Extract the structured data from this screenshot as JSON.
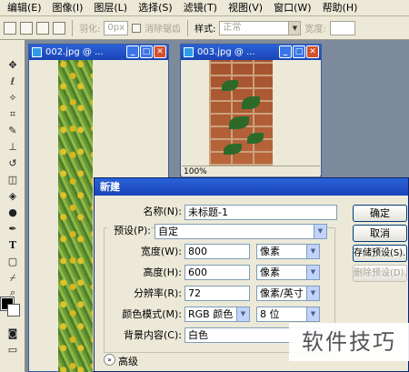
{
  "menu": [
    "编辑(E)",
    "图像(I)",
    "图层(L)",
    "选择(S)",
    "滤镜(T)",
    "视图(V)",
    "窗口(W)",
    "帮助(H)"
  ],
  "options": {
    "feather_label": "羽化:",
    "feather_value": "0px",
    "antialias_label": "消除锯齿",
    "style_label": "样式:",
    "style_value": "正常",
    "width_label": "宽度:"
  },
  "windows": {
    "w1_title": "002.jpg @ ...",
    "w2_title": "003.jpg @ ...",
    "w2_zoom": "100%"
  },
  "dialog": {
    "title": "新建",
    "name_label": "名称(N):",
    "name_value": "未标题-1",
    "preset_label": "预设(P):",
    "preset_value": "自定",
    "width_label": "宽度(W):",
    "width_value": "800",
    "width_unit": "像素",
    "height_label": "高度(H):",
    "height_value": "600",
    "height_unit": "像素",
    "res_label": "分辨率(R):",
    "res_value": "72",
    "res_unit": "像素/英寸",
    "mode_label": "颜色模式(M):",
    "mode_value": "RGB 颜色",
    "bits_value": "8 位",
    "bg_label": "背景内容(C):",
    "bg_value": "白色",
    "advanced_label": "高级",
    "ok_label": "确定",
    "cancel_label": "取消",
    "save_preset_label": "存储预设(S)...",
    "delete_preset_label": "删除预设(D)..."
  },
  "watermark": "软件技巧",
  "colors": {
    "titlebar": "#2a62d8",
    "dialog_bg": "#ece9d8"
  }
}
